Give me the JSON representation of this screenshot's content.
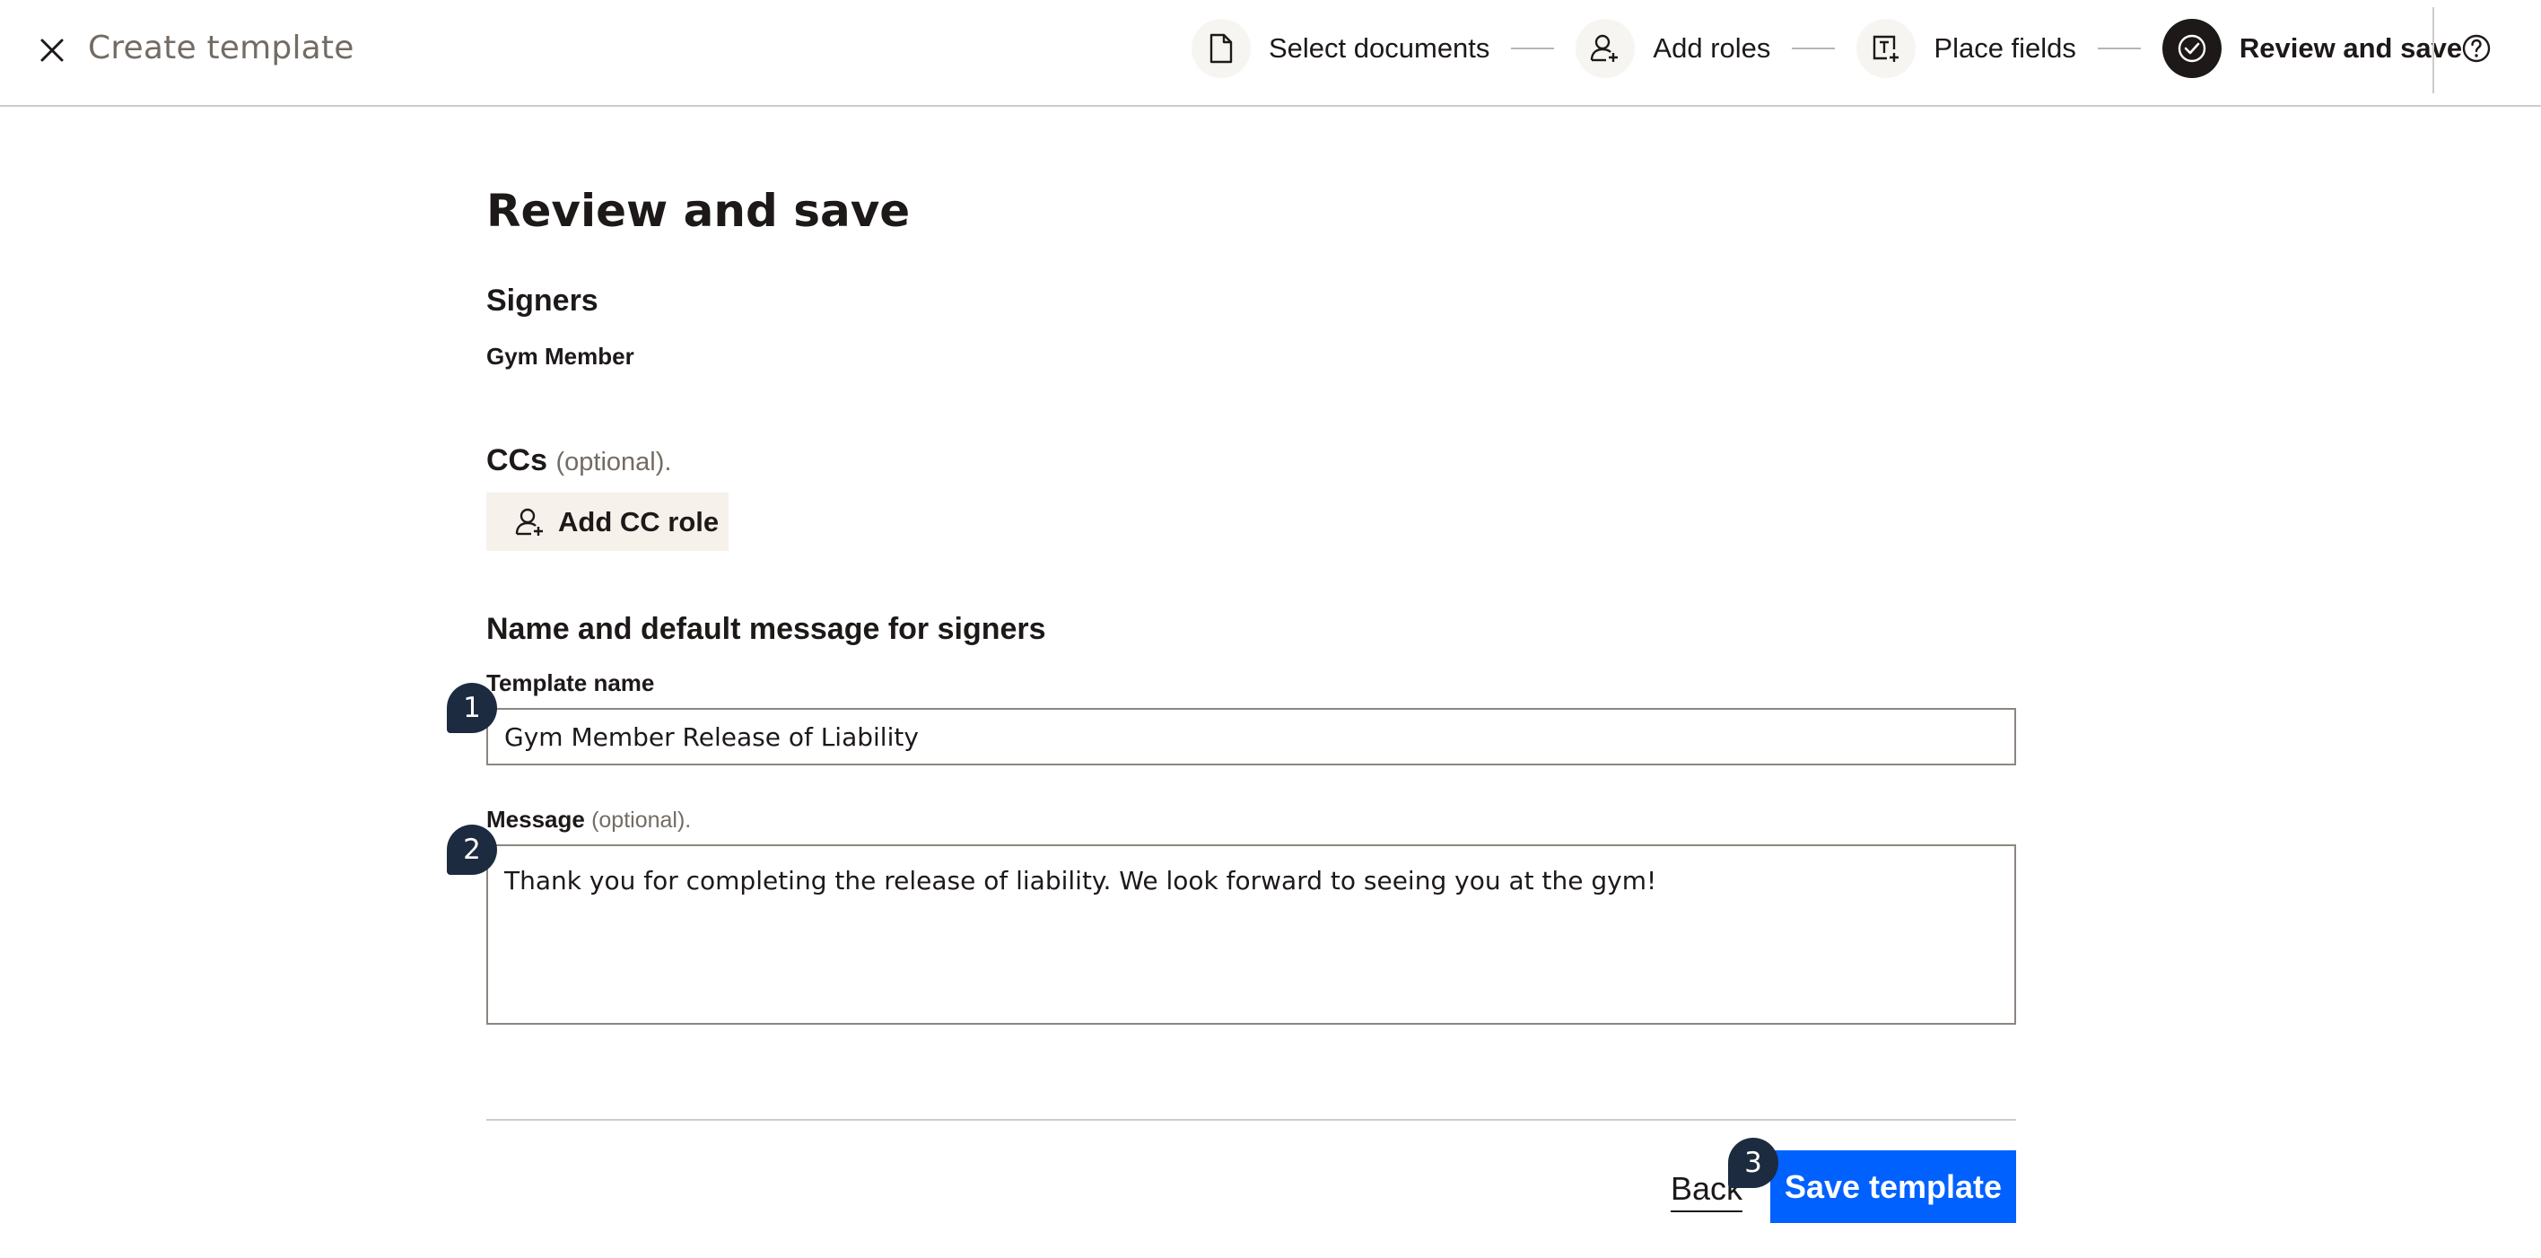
{
  "header": {
    "title": "Create template",
    "steps": [
      {
        "label": "Select documents",
        "icon": "document-icon",
        "active": false
      },
      {
        "label": "Add roles",
        "icon": "add-person-icon",
        "active": false
      },
      {
        "label": "Place fields",
        "icon": "text-field-icon",
        "active": false
      },
      {
        "label": "Review and save",
        "icon": "check-circle-icon",
        "active": true
      }
    ]
  },
  "main": {
    "page_title": "Review and save",
    "signers": {
      "heading": "Signers",
      "items": [
        "Gym Member"
      ]
    },
    "ccs": {
      "heading": "CCs",
      "optional": "(optional).",
      "add_button": "Add CC role"
    },
    "name_message": {
      "heading": "Name and default message for signers",
      "template_name_label": "Template name",
      "template_name_value": "Gym Member Release of Liability",
      "message_label": "Message",
      "message_optional": "(optional).",
      "message_value": "Thank you for completing the release of liability. We look forward to seeing you at the gym!"
    },
    "footer": {
      "back_label": "Back",
      "save_label": "Save template"
    },
    "markers": [
      "1",
      "2",
      "3"
    ]
  },
  "colors": {
    "primary_button": "#0061fe",
    "marker": "#1c2b3f",
    "active_step": "#1e1919",
    "secondary_button_bg": "#f7f1ec"
  }
}
